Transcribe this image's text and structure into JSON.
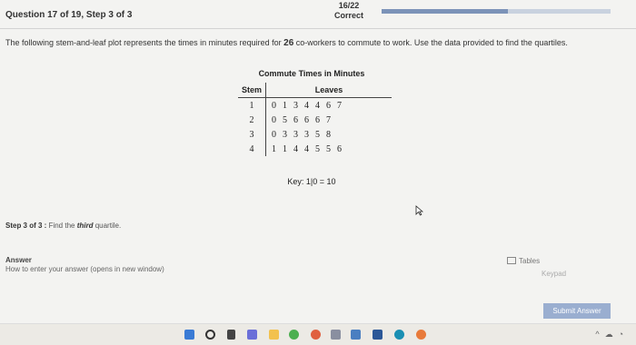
{
  "header": {
    "question": "Question 17 of 19, Step 3 of 3",
    "score": "16/22",
    "status": "Correct",
    "progress_fraction": 0.55
  },
  "prompt": {
    "before": "The following stem-and-leaf plot represents the times in minutes required for ",
    "count": "26",
    "after": " co-workers to commute to work. Use the data provided to find the quartiles."
  },
  "plot": {
    "title": "Commute Times in Minutes",
    "stem_header": "Stem",
    "leaves_header": "Leaves",
    "rows": [
      {
        "stem": "1",
        "leaves": [
          "0",
          "1",
          "3",
          "4",
          "4",
          "6",
          "7"
        ]
      },
      {
        "stem": "2",
        "leaves": [
          "0",
          "5",
          "6",
          "6",
          "6",
          "7"
        ]
      },
      {
        "stem": "3",
        "leaves": [
          "0",
          "3",
          "3",
          "3",
          "5",
          "8"
        ]
      },
      {
        "stem": "4",
        "leaves": [
          "1",
          "1",
          "4",
          "4",
          "5",
          "5",
          "6"
        ]
      }
    ],
    "key": "Key: 1|0 = 10"
  },
  "step": {
    "label": "Step 3 of 3 :",
    "before": " Find the ",
    "emphasis": "third",
    "after": " quartile."
  },
  "answer": {
    "label": "Answer",
    "help_link": "How to enter your answer (opens in new window)"
  },
  "tools": {
    "tables": "Tables",
    "keypad": "Keypad"
  },
  "submit_label": "Submit Answer",
  "colors": {
    "progress_fill": "#7c93b8",
    "submit_bg": "#9aaed0"
  },
  "taskbar": {
    "icons": [
      "windows-icon",
      "search-icon",
      "task-view-icon",
      "chat-icon",
      "file-explorer-icon",
      "chrome-icon",
      "photos-icon",
      "store-icon",
      "app-icon",
      "mail-icon",
      "edge-icon",
      "media-icon"
    ]
  }
}
